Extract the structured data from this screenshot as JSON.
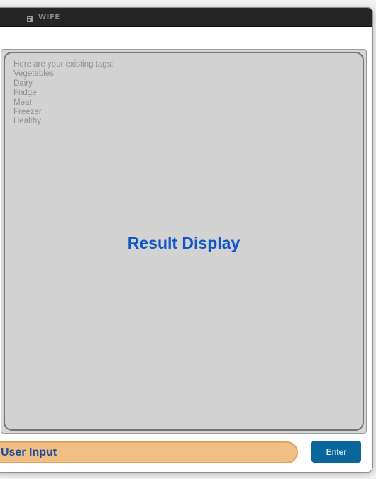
{
  "window": {
    "title": "WIFE"
  },
  "result_display": {
    "lines": [
      "Here are your existing tags:",
      "Vegetables",
      "Dairy",
      "Fridge",
      "Meat",
      "Freezer",
      "Healthy"
    ],
    "center_label": "Result Display"
  },
  "command_box": {
    "placeholder": "User Input",
    "value": ""
  },
  "buttons": {
    "enter_label": "Enter"
  },
  "colors": {
    "titlebar": "#252525",
    "result_background": "#d6d6d6",
    "result_text": "#8f8f8f",
    "accent_blue": "#1155c6",
    "input_background": "#efbf86",
    "button_background": "#0b679b"
  },
  "icons": {
    "app_icon": "app-icon"
  }
}
